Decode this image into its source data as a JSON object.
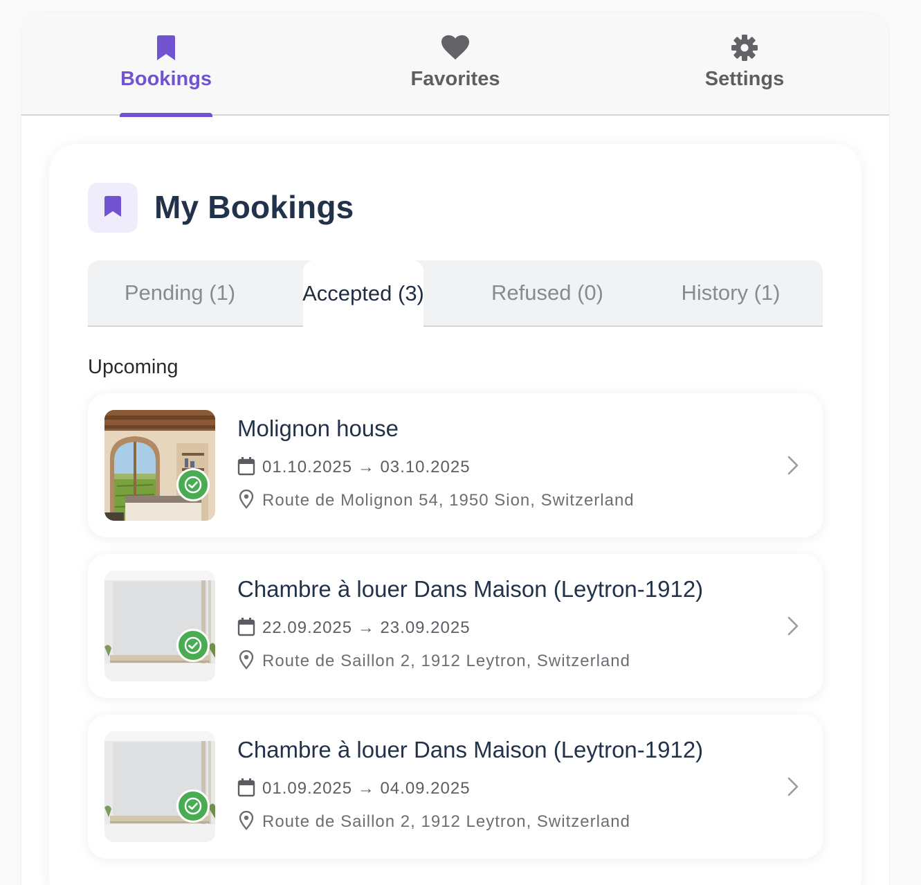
{
  "nav": {
    "tabs": [
      {
        "label": "Bookings",
        "icon": "bookmark-icon",
        "active": true
      },
      {
        "label": "Favorites",
        "icon": "heart-icon",
        "active": false
      },
      {
        "label": "Settings",
        "icon": "gear-icon",
        "active": false
      }
    ]
  },
  "header": {
    "title": "My Bookings",
    "icon": "bookmark-icon"
  },
  "status_tabs": [
    {
      "label": "Pending (1)",
      "active": false
    },
    {
      "label": "Accepted (3)",
      "active": true
    },
    {
      "label": "Refused (0)",
      "active": false
    },
    {
      "label": "History (1)",
      "active": false
    }
  ],
  "section": {
    "label": "Upcoming"
  },
  "bookings": [
    {
      "title": "Molignon house",
      "dates": "01.10.2025 → 03.10.2025",
      "address": "Route de Molignon 54, 1950 Sion, Switzerland",
      "status_icon": "check-circle-icon"
    },
    {
      "title": "Chambre à louer Dans Maison (Leytron-1912)",
      "dates": "22.09.2025 → 23.09.2025",
      "address": "Route de Saillon 2, 1912 Leytron, Switzerland",
      "status_icon": "check-circle-icon"
    },
    {
      "title": "Chambre à louer Dans Maison (Leytron-1912)",
      "dates": "01.09.2025 → 04.09.2025",
      "address": "Route de Saillon 2, 1912 Leytron, Switzerland",
      "status_icon": "check-circle-icon"
    }
  ],
  "colors": {
    "accent": "#7153d0",
    "title": "#22324a",
    "success": "#4aac52",
    "muted": "#858a93"
  }
}
